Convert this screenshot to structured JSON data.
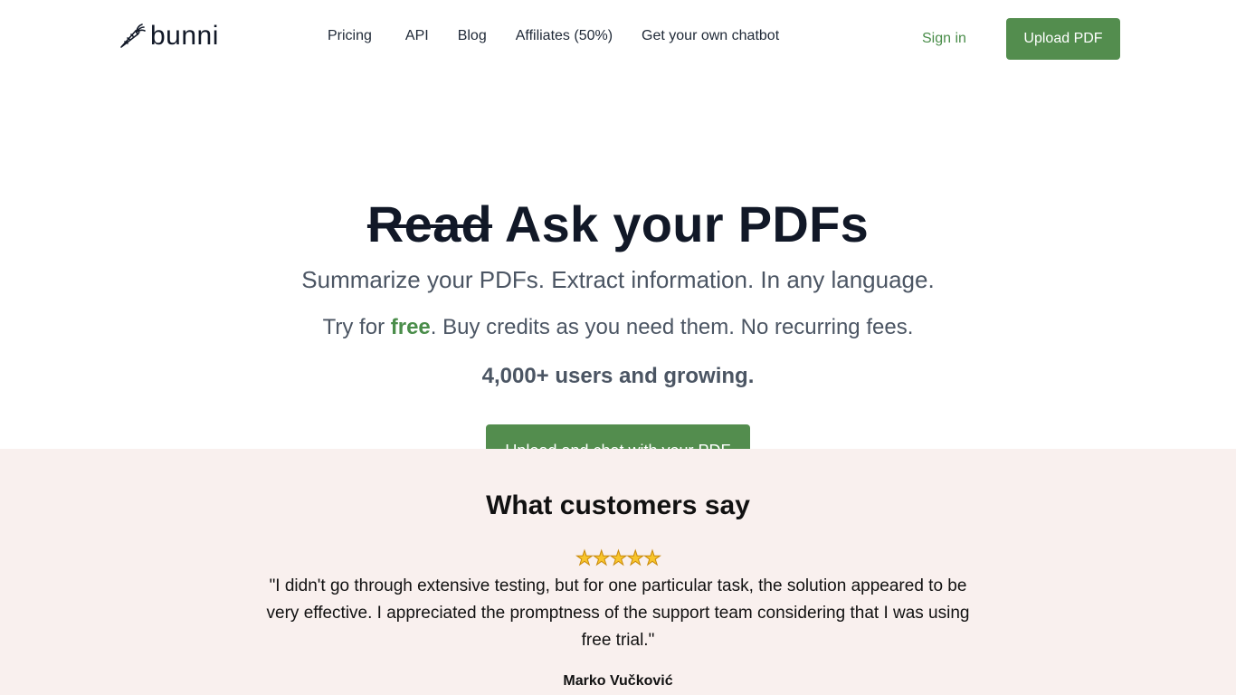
{
  "header": {
    "logo_text": "bunni",
    "logo_icon": "carrot-icon",
    "nav": [
      {
        "label": "Pricing"
      },
      {
        "label": "API"
      },
      {
        "label": "Blog"
      },
      {
        "label": "Affiliates (50%)"
      },
      {
        "label": "Get your own chatbot"
      }
    ],
    "signin_label": "Sign in",
    "upload_label": "Upload PDF"
  },
  "hero": {
    "title_struck": "Read",
    "title_rest": " Ask your PDFs",
    "subtitle": "Summarize your PDFs. Extract information. In any language.",
    "free_prefix": "Try for ",
    "free_word": "free",
    "free_suffix": ". Buy credits as you need them. No recurring fees.",
    "users": "4,000+ users and growing.",
    "cta_label": "Upload and chat with your PDF"
  },
  "testimonials": {
    "title": "What customers say",
    "stars": "⭐⭐⭐⭐⭐",
    "rating": 5,
    "quote": "\"I didn't go through extensive testing, but for one particular task, the solution appeared to be very effective. I appreciated the promptness of the support team considering that I was using free trial.\"",
    "author": "Marko Vučković"
  },
  "colors": {
    "accent": "#538d4e",
    "accent_text": "#4a8d4a",
    "testimonial_bg": "#f9f0ee",
    "title": "#111827",
    "muted": "#4b5563"
  }
}
